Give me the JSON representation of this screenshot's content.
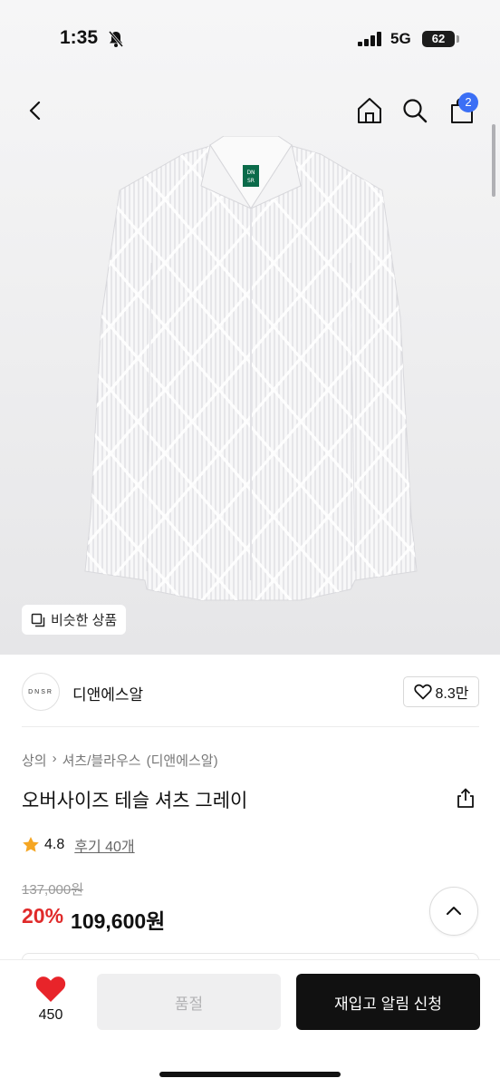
{
  "status_bar": {
    "time": "1:35",
    "network": "5G",
    "battery": "62"
  },
  "nav": {
    "cart_count": "2"
  },
  "hero": {
    "brand_tag": "DNSR",
    "similar_label": "비슷한 상품"
  },
  "brand": {
    "logo_text": "DNSR",
    "name": "디앤에스알",
    "likes": "8.3만"
  },
  "product": {
    "breadcrumb": [
      "상의",
      "셔츠/블라우스",
      "(디앤에스알)"
    ],
    "title": "오버사이즈 테슬 셔츠 그레이",
    "rating": "4.8",
    "reviews": "후기 40개",
    "original_price": "137,000원",
    "discount": "20%",
    "price": "109,600원"
  },
  "bottom": {
    "heart_count": "450",
    "soldout_label": "품절",
    "restock_label": "재입고 알림 신청"
  },
  "colors": {
    "accent": "#3b6ff5",
    "discount": "#e02a2a",
    "heart": "#e8242a",
    "star": "#f5a623"
  }
}
